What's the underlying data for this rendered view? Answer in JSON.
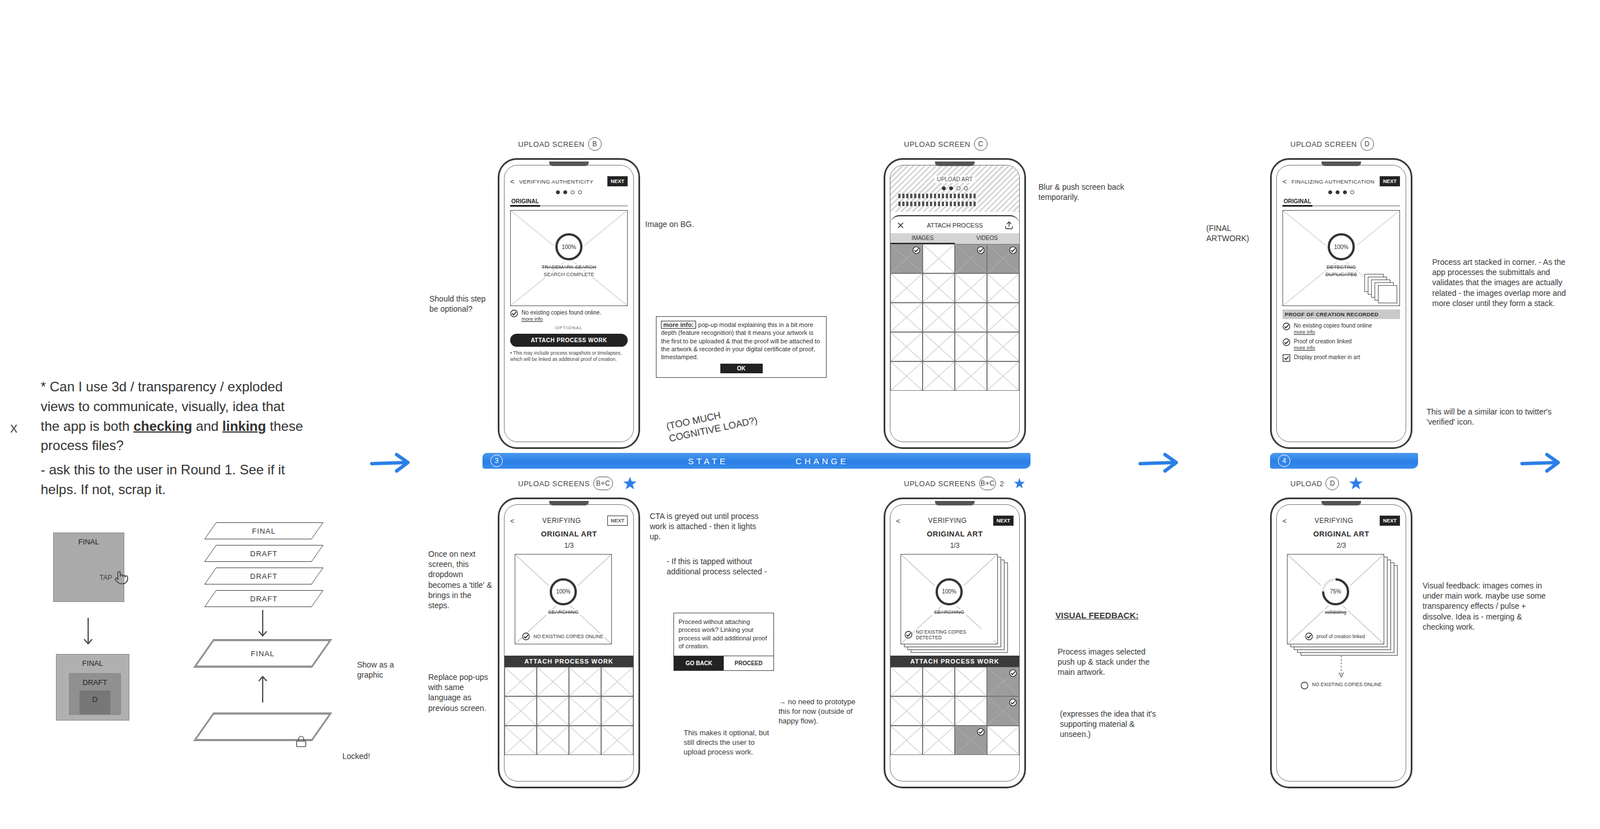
{
  "margin_mark": "x",
  "idea_note": {
    "segments": [
      {
        "text": "* Can I use 3d / transparency / exploded views to communicate, visually, idea that the app is both ",
        "emphasis": false
      },
      {
        "text": "checking",
        "emphasis": true
      },
      {
        "text": " and ",
        "emphasis": false
      },
      {
        "text": "linking",
        "emphasis": true
      },
      {
        "text": " these process files?",
        "emphasis": false
      }
    ],
    "followup": "- ask this to the user in Round 1. See if it helps. If not, scrap it."
  },
  "sketch": {
    "tap_before": "FINAL",
    "tap_label": "TAP",
    "tap_after": [
      "FINAL",
      "DRAFT",
      "D"
    ],
    "exploded": [
      "FINAL",
      "DRAFT",
      "DRAFT",
      "DRAFT"
    ],
    "merged": "FINAL",
    "graphic_note": "Show as a graphic",
    "locked_note": "Locked!"
  },
  "state_bars": [
    {
      "number": "3",
      "label": "STATE CHANGE"
    },
    {
      "number": "4",
      "label": ""
    }
  ],
  "screens": [
    {
      "caption": "UPLOAD SCREEN",
      "badge": "B",
      "suffix": "",
      "starred": false,
      "header": {
        "back": "<",
        "title": "VERIFYING AUTHENTICITY",
        "next": "NEXT",
        "active": true,
        "steps": [
          true,
          true,
          false,
          false
        ]
      },
      "tab": "ORIGINAL",
      "art": {
        "percent": "100%",
        "level": 1,
        "lines": [
          {
            "text": "TRADEMARK SEARCH",
            "struck": true
          },
          {
            "text": "SEARCH COMPLETE",
            "struck": false
          }
        ],
        "check": "",
        "layers": 0,
        "corner": false
      },
      "checks": [
        {
          "label": "No existing copies found online.",
          "link": "more info",
          "checked": true,
          "kind": "circle"
        }
      ],
      "optional": "OPTIONAL",
      "button": "ATTACH PROCESS WORK",
      "footnote": "• This may include process snapshots or timelapses, which will be linked as additional proof of creation."
    },
    {
      "caption": "UPLOAD SCREEN",
      "badge": "C",
      "suffix": "",
      "starred": false,
      "backdrop": {
        "title": "UPLOAD ART",
        "steps": [
          true,
          true,
          false,
          false
        ]
      },
      "sheet": {
        "title": "ATTACH PROCESS",
        "tabs": [
          {
            "label": "IMAGES",
            "selected": true
          },
          {
            "label": "VIDEOS",
            "selected": false
          }
        ]
      },
      "grid": {
        "cells": [
          true,
          false,
          true,
          true,
          false,
          false,
          false,
          false,
          false,
          false,
          false,
          false,
          false,
          false,
          false,
          false,
          false,
          false,
          false,
          false
        ]
      }
    },
    {
      "caption": "UPLOAD SCREEN",
      "badge": "D",
      "suffix": "",
      "starred": false,
      "header": {
        "back": "<",
        "title": "FINALIZING AUTHENTICATION",
        "next": "NEXT",
        "active": true,
        "steps": [
          true,
          true,
          true,
          false
        ]
      },
      "tab": "ORIGINAL",
      "art": {
        "percent": "100%",
        "level": 1,
        "lines": [
          {
            "text": "DETECTING",
            "struck": true
          },
          {
            "text": "DUPLICATES",
            "struck": true
          }
        ],
        "check": "",
        "layers": 5,
        "corner": true
      },
      "section": "PROOF OF CREATION RECORDED",
      "checks": [
        {
          "label": "No existing copies found online",
          "link": "more info",
          "checked": true,
          "kind": "circle"
        },
        {
          "label": "Proof of creation linked",
          "link": "more info",
          "checked": true,
          "kind": "circle"
        },
        {
          "label": "Display proof marker in art",
          "link": "",
          "checked": true,
          "kind": "square"
        }
      ]
    },
    {
      "caption": "UPLOAD SCREENS",
      "badge": "B+C",
      "suffix": "",
      "starred": true,
      "header": {
        "back": "<",
        "title": "VERIFYING",
        "next": "NEXT",
        "active": false
      },
      "subtitle": "ORIGINAL ART",
      "count": "1/3",
      "art": {
        "percent": "100%",
        "level": 1,
        "lines": [
          {
            "text": "SEARCHING",
            "struck": true
          }
        ],
        "check": "NO EXISTING COPIES ONLINE",
        "layers": 0,
        "corner": false
      },
      "bar": "ATTACH PROCESS WORK",
      "grid": {
        "cells": [
          false,
          false,
          false,
          false,
          false,
          false,
          false,
          false,
          false,
          false,
          false,
          false
        ]
      }
    },
    {
      "caption": "UPLOAD SCREENS",
      "badge": "B+C",
      "suffix": "2",
      "starred": true,
      "header": {
        "back": "<",
        "title": "VERIFYING",
        "next": "NEXT",
        "active": true
      },
      "subtitle": "ORIGINAL ART",
      "count": "1/3",
      "art": {
        "percent": "100%",
        "level": 1,
        "lines": [
          {
            "text": "SEARCHING",
            "struck": true
          }
        ],
        "check": "NO EXISTING COPIES DETECTED",
        "layers": 3,
        "corner": false
      },
      "bar": "ATTACH PROCESS WORK",
      "grid": {
        "cells": [
          false,
          false,
          false,
          true,
          false,
          false,
          false,
          true,
          false,
          false,
          true,
          false
        ]
      }
    },
    {
      "caption": "UPLOAD",
      "badge": "D",
      "suffix": "",
      "starred": true,
      "header": {
        "back": "<",
        "title": "VERIFYING",
        "next": "NEXT",
        "active": true
      },
      "subtitle": "ORIGINAL ART",
      "count": "2/3",
      "art": {
        "percent": "75%",
        "level": 0.75,
        "lines": [
          {
            "text": "validating",
            "struck": true
          }
        ],
        "check": "proof of creation linked",
        "layers": 4,
        "corner": false
      },
      "below": "NO EXISTING COPIES ONLINE"
    }
  ],
  "popup_note": {
    "label": "more info:",
    "text": "pop-up modal explaining this in a bit more depth (feature recognition) that it means your artwork is the first to be uploaded & that the proof will be attached to the artwork & recorded in your digital certificate of proof, timestamped.",
    "button": "OK"
  },
  "modal": {
    "text": "Proceed without attaching process work? Linking your process will add additional proof of creation.",
    "buttons": [
      {
        "label": "GO BACK",
        "primary": true
      },
      {
        "label": "PROCEED",
        "primary": false
      }
    ]
  },
  "annotations": [
    {
      "text": "Should this step be optional?",
      "emphasis": false
    },
    {
      "text": "Image on BG.",
      "emphasis": false
    },
    {
      "text": "(TOO MUCH COGNITIVE LOAD?)",
      "emphasis": false
    },
    {
      "text": "Blur & push screen back temporarily.",
      "emphasis": false
    },
    {
      "text": "(FINAL ARTWORK)",
      "emphasis": false
    },
    {
      "text": "Process art stacked in corner. - As the app processes the submittals and validates that the images are actually related - the images overlap more and more closer until they form a stack.",
      "emphasis": false
    },
    {
      "text": "This will be a similar icon to twitter's 'verified' icon.",
      "emphasis": false
    },
    {
      "text": "Once on next screen, this dropdown becomes a 'title' & brings in the steps.",
      "emphasis": false
    },
    {
      "text": "Replace pop-ups with same language as previous screen.",
      "emphasis": false
    },
    {
      "text": "CTA is greyed out until process work is attached - then it lights up.",
      "emphasis": false
    },
    {
      "text": "- If this is tapped without additional process selected -",
      "emphasis": false
    },
    {
      "text": "→ no need to prototype this for now (outside of happy flow).",
      "emphasis": false
    },
    {
      "text": "This makes it optional, but still directs the user to upload process work.",
      "emphasis": false
    },
    {
      "text": "VISUAL FEEDBACK:",
      "emphasis": true
    },
    {
      "text": "Process images selected push up & stack under the main artwork.",
      "emphasis": false
    },
    {
      "text": "(expresses the idea that it's supporting material & unseen.)",
      "emphasis": false
    },
    {
      "text": "Visual feedback: images comes in under main work. maybe use some transparency effects / pulse + dissolve. Idea is - merging & checking work.",
      "emphasis": false
    }
  ]
}
